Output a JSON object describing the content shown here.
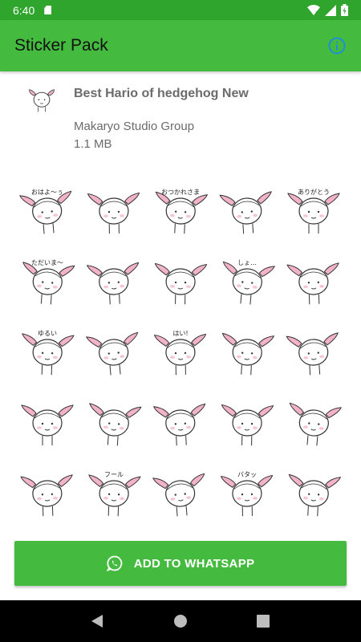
{
  "status_bar": {
    "time": "6:40",
    "icons": [
      "sd-card-icon",
      "wifi-icon",
      "signal-icon",
      "battery-icon"
    ]
  },
  "app_bar": {
    "title": "Sticker Pack",
    "info_icon": "info-icon"
  },
  "pack": {
    "name": "Best Hario of hedgehog New",
    "publisher": "Makaryo Studio Group",
    "size": "1.1 MB"
  },
  "stickers": [
    {
      "caption": "おはよ〜ぅ"
    },
    {
      "caption": ""
    },
    {
      "caption": "おつかれさま"
    },
    {
      "caption": ""
    },
    {
      "caption": "ありがとう"
    },
    {
      "caption": "ただいま〜"
    },
    {
      "caption": ""
    },
    {
      "caption": ""
    },
    {
      "caption": "しょ…"
    },
    {
      "caption": ""
    },
    {
      "caption": "ゆるい"
    },
    {
      "caption": ""
    },
    {
      "caption": "はい!"
    },
    {
      "caption": ""
    },
    {
      "caption": ""
    },
    {
      "caption": ""
    },
    {
      "caption": ""
    },
    {
      "caption": ""
    },
    {
      "caption": ""
    },
    {
      "caption": ""
    },
    {
      "caption": ""
    },
    {
      "caption": "フール"
    },
    {
      "caption": ""
    },
    {
      "caption": "バタッ"
    },
    {
      "caption": ""
    }
  ],
  "actions": {
    "add_to_whatsapp": "ADD TO WHATSAPP"
  },
  "colors": {
    "status_bar": "#2fa52e",
    "app_bar": "#44bb3f",
    "button": "#44bb3f",
    "info_icon": "#1e8fd8",
    "ear_pink": "#f2b3c9"
  }
}
